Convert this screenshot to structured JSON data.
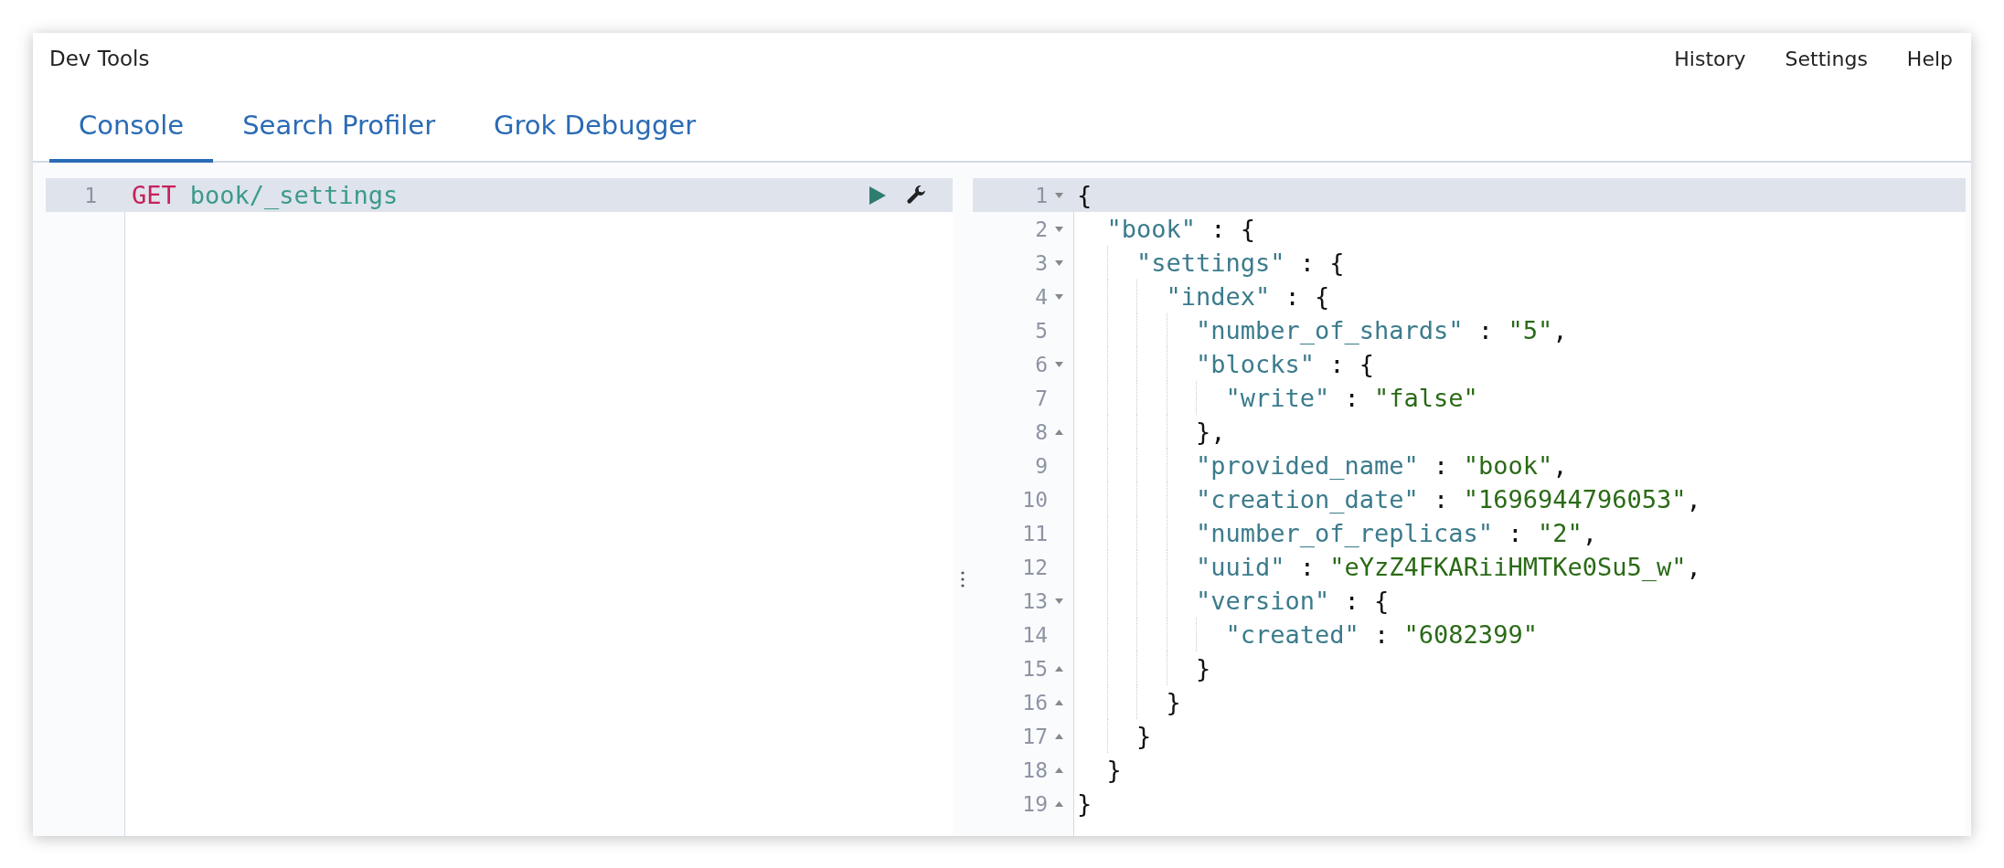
{
  "app": {
    "title": "Dev Tools"
  },
  "top_links": [
    "History",
    "Settings",
    "Help"
  ],
  "tabs": [
    {
      "label": "Console",
      "selected": true
    },
    {
      "label": "Search Profiler",
      "selected": false
    },
    {
      "label": "Grok Debugger",
      "selected": false
    }
  ],
  "request_editor": {
    "lines": [
      {
        "number": "1",
        "selected": true,
        "method": "GET",
        "path": "book/_settings"
      }
    ]
  },
  "response_viewer": {
    "lines": [
      {
        "number": "1",
        "fold_start": true,
        "fold_end": false,
        "selected": true,
        "tokens": [
          {
            "kind": "punct",
            "text": "{"
          }
        ],
        "children": [
          {
            "number": "2",
            "fold_start": true,
            "fold_end": false,
            "selected": false,
            "tokens": [
              {
                "kind": "key",
                "text": "\"book\""
              },
              {
                "kind": "punct",
                "text": " : {"
              }
            ],
            "children": [
              {
                "number": "3",
                "fold_start": true,
                "fold_end": false,
                "selected": false,
                "tokens": [
                  {
                    "kind": "key",
                    "text": "\"settings\""
                  },
                  {
                    "kind": "punct",
                    "text": " : {"
                  }
                ],
                "children": [
                  {
                    "number": "4",
                    "fold_start": true,
                    "fold_end": false,
                    "selected": false,
                    "tokens": [
                      {
                        "kind": "key",
                        "text": "\"index\""
                      },
                      {
                        "kind": "punct",
                        "text": " : {"
                      }
                    ],
                    "children": [
                      {
                        "number": "5",
                        "fold_start": false,
                        "fold_end": false,
                        "selected": false,
                        "tokens": [
                          {
                            "kind": "key",
                            "text": "\"number_of_shards\""
                          },
                          {
                            "kind": "punct",
                            "text": " : "
                          },
                          {
                            "kind": "string",
                            "text": "\"5\""
                          },
                          {
                            "kind": "punct",
                            "text": ","
                          }
                        ]
                      },
                      {
                        "number": "6",
                        "fold_start": true,
                        "fold_end": false,
                        "selected": false,
                        "tokens": [
                          {
                            "kind": "key",
                            "text": "\"blocks\""
                          },
                          {
                            "kind": "punct",
                            "text": " : {"
                          }
                        ],
                        "children": [
                          {
                            "number": "7",
                            "fold_start": false,
                            "fold_end": false,
                            "selected": false,
                            "tokens": [
                              {
                                "kind": "key",
                                "text": "\"write\""
                              },
                              {
                                "kind": "punct",
                                "text": " : "
                              },
                              {
                                "kind": "string",
                                "text": "\"false\""
                              }
                            ]
                          }
                        ]
                      },
                      {
                        "number": "8",
                        "fold_start": false,
                        "fold_end": true,
                        "selected": false,
                        "tokens": [
                          {
                            "kind": "punct",
                            "text": "},"
                          }
                        ]
                      },
                      {
                        "number": "9",
                        "fold_start": false,
                        "fold_end": false,
                        "selected": false,
                        "tokens": [
                          {
                            "kind": "key",
                            "text": "\"provided_name\""
                          },
                          {
                            "kind": "punct",
                            "text": " : "
                          },
                          {
                            "kind": "string",
                            "text": "\"book\""
                          },
                          {
                            "kind": "punct",
                            "text": ","
                          }
                        ]
                      },
                      {
                        "number": "10",
                        "fold_start": false,
                        "fold_end": false,
                        "selected": false,
                        "tokens": [
                          {
                            "kind": "key",
                            "text": "\"creation_date\""
                          },
                          {
                            "kind": "punct",
                            "text": " : "
                          },
                          {
                            "kind": "string",
                            "text": "\"1696944796053\""
                          },
                          {
                            "kind": "punct",
                            "text": ","
                          }
                        ]
                      },
                      {
                        "number": "11",
                        "fold_start": false,
                        "fold_end": false,
                        "selected": false,
                        "tokens": [
                          {
                            "kind": "key",
                            "text": "\"number_of_replicas\""
                          },
                          {
                            "kind": "punct",
                            "text": " : "
                          },
                          {
                            "kind": "string",
                            "text": "\"2\""
                          },
                          {
                            "kind": "punct",
                            "text": ","
                          }
                        ]
                      },
                      {
                        "number": "12",
                        "fold_start": false,
                        "fold_end": false,
                        "selected": false,
                        "tokens": [
                          {
                            "kind": "key",
                            "text": "\"uuid\""
                          },
                          {
                            "kind": "punct",
                            "text": " : "
                          },
                          {
                            "kind": "string",
                            "text": "\"eYzZ4FKARiiHMTKe0Su5_w\""
                          },
                          {
                            "kind": "punct",
                            "text": ","
                          }
                        ]
                      },
                      {
                        "number": "13",
                        "fold_start": true,
                        "fold_end": false,
                        "selected": false,
                        "tokens": [
                          {
                            "kind": "key",
                            "text": "\"version\""
                          },
                          {
                            "kind": "punct",
                            "text": " : {"
                          }
                        ],
                        "children": [
                          {
                            "number": "14",
                            "fold_start": false,
                            "fold_end": false,
                            "selected": false,
                            "tokens": [
                              {
                                "kind": "key",
                                "text": "\"created\""
                              },
                              {
                                "kind": "punct",
                                "text": " : "
                              },
                              {
                                "kind": "string",
                                "text": "\"6082399\""
                              }
                            ]
                          }
                        ]
                      },
                      {
                        "number": "15",
                        "fold_start": false,
                        "fold_end": true,
                        "selected": false,
                        "tokens": [
                          {
                            "kind": "punct",
                            "text": "}"
                          }
                        ]
                      }
                    ]
                  },
                  {
                    "number": "16",
                    "fold_start": false,
                    "fold_end": true,
                    "selected": false,
                    "tokens": [
                      {
                        "kind": "punct",
                        "text": "}"
                      }
                    ]
                  }
                ]
              },
              {
                "number": "17",
                "fold_start": false,
                "fold_end": true,
                "selected": false,
                "tokens": [
                  {
                    "kind": "punct",
                    "text": "}"
                  }
                ]
              }
            ]
          },
          {
            "number": "18",
            "fold_start": false,
            "fold_end": true,
            "selected": false,
            "tokens": [
              {
                "kind": "punct",
                "text": "}"
              }
            ]
          }
        ]
      },
      {
        "number": "19",
        "fold_start": false,
        "fold_end": true,
        "selected": false,
        "tokens": [
          {
            "kind": "punct",
            "text": "}"
          }
        ]
      }
    ]
  }
}
